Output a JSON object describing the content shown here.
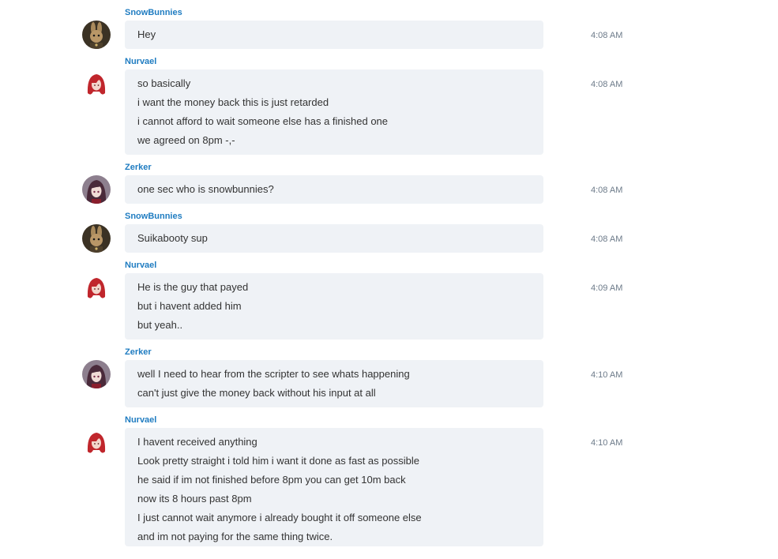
{
  "messages": [
    {
      "sender": "SnowBunnies",
      "avatar": "rabbit",
      "time": "4:08 AM",
      "lines": [
        "Hey"
      ]
    },
    {
      "sender": "Nurvael",
      "avatar": "red-hair",
      "time": "4:08 AM",
      "lines": [
        "so basically",
        "i want the money back this is just retarded",
        "i cannot afford to wait someone else has a finished one",
        "we agreed on 8pm -,-"
      ]
    },
    {
      "sender": "Zerker",
      "avatar": "dark-hair",
      "time": "4:08 AM",
      "lines": [
        "one sec who is snowbunnies?"
      ]
    },
    {
      "sender": "SnowBunnies",
      "avatar": "rabbit",
      "time": "4:08 AM",
      "lines": [
        "Suikabooty sup"
      ]
    },
    {
      "sender": "Nurvael",
      "avatar": "red-hair",
      "time": "4:09 AM",
      "lines": [
        "He is the guy that payed",
        "but i havent added him",
        "but yeah.."
      ]
    },
    {
      "sender": "Zerker",
      "avatar": "dark-hair",
      "time": "4:10 AM",
      "lines": [
        "well I need to hear from the scripter to see whats happening",
        "can't just give the money back without his input at all"
      ]
    },
    {
      "sender": "Nurvael",
      "avatar": "red-hair",
      "time": "4:10 AM",
      "lines": [
        "I havent received anything",
        "Look pretty straight i told him i want it done as fast as possible",
        "he said if im not finished before 8pm you can get 10m back",
        "now its 8 hours past 8pm",
        "I just cannot wait anymore i already bought it off someone else",
        "and im not paying for the same thing twice."
      ]
    }
  ],
  "colors": {
    "sender": "#1f7cc1",
    "bubble": "#eff2f6",
    "text": "#333333",
    "time": "#6c7a89"
  }
}
